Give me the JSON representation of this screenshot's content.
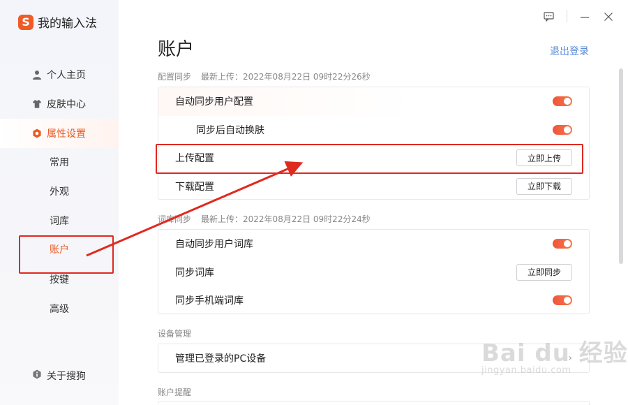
{
  "app": {
    "logo_glyph": "S",
    "title": "我的输入法",
    "accent": "#ea5a23",
    "link_color": "#5a8bd8"
  },
  "window_controls": {
    "feedback": "feedback-icon",
    "minimize": "minimize-icon",
    "close": "close-icon"
  },
  "sidebar": {
    "items": [
      {
        "label": "个人主页",
        "icon": "user-icon"
      },
      {
        "label": "皮肤中心",
        "icon": "shirt-icon"
      },
      {
        "label": "属性设置",
        "icon": "settings-hex-icon",
        "active": true
      }
    ],
    "sub_items": [
      "常用",
      "外观",
      "词库",
      "账户",
      "按键",
      "高级"
    ],
    "active_sub": "账户",
    "about": "关于搜狗"
  },
  "main": {
    "title": "账户",
    "logout": "退出登录",
    "config_sync": {
      "label": "配置同步",
      "last_upload": "最新上传：2022年08月22日 09时22分26秒",
      "rows": [
        {
          "label": "自动同步用户配置",
          "toggle": true
        },
        {
          "label": "同步后自动换肤",
          "toggle": true
        },
        {
          "label": "上传配置",
          "button": "立即上传"
        },
        {
          "label": "下载配置",
          "button": "立即下载"
        }
      ]
    },
    "dict_sync": {
      "label": "词库同步",
      "last_upload": "最新上传：2022年08月22日 09时22分24秒",
      "rows": [
        {
          "label": "自动同步用户词库",
          "toggle": true
        },
        {
          "label": "同步词库",
          "button": "立即同步"
        },
        {
          "label": "同步手机端词库",
          "toggle": true
        }
      ]
    },
    "device": {
      "label": "设备管理",
      "row": "管理已登录的PC设备"
    },
    "reminder": {
      "label": "账户提醒"
    }
  },
  "watermark": {
    "main": "Bai du 经验",
    "sub": "jingyan.baidu.com"
  }
}
